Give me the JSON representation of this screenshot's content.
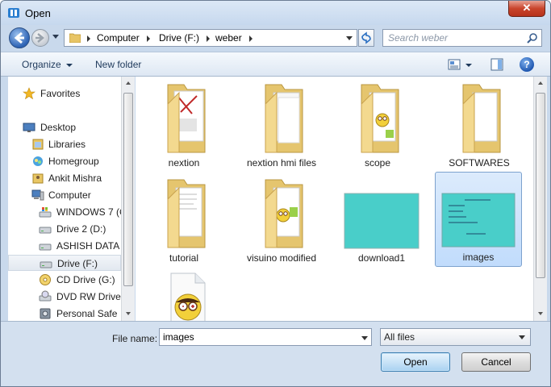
{
  "window": {
    "title": "Open",
    "close_glyph": "✕"
  },
  "navigation": {
    "breadcrumbs": [
      "Computer",
      "Drive (F:)",
      "weber"
    ],
    "search_placeholder": "Search weber"
  },
  "toolbar": {
    "organize_label": "Organize",
    "new_folder_label": "New folder",
    "help_glyph": "?"
  },
  "sidebar": {
    "items": [
      {
        "label": "Favorites",
        "icon": "star-icon"
      },
      {
        "label": "Desktop",
        "icon": "desktop-icon"
      },
      {
        "label": "Libraries",
        "icon": "library-icon"
      },
      {
        "label": "Homegroup",
        "icon": "homegroup-icon"
      },
      {
        "label": "Ankit Mishra",
        "icon": "user-folder-icon"
      },
      {
        "label": "Computer",
        "icon": "computer-icon"
      },
      {
        "label": "WINDOWS 7  (C",
        "icon": "windows-drive-icon"
      },
      {
        "label": "Drive 2 (D:)",
        "icon": "drive-icon"
      },
      {
        "label": "ASHISH DATA",
        "icon": "drive-icon"
      },
      {
        "label": "Drive (F:)",
        "icon": "drive-icon",
        "selected": true
      },
      {
        "label": "CD Drive (G:)",
        "icon": "cd-icon"
      },
      {
        "label": "DVD RW Drive (",
        "icon": "dvd-icon"
      },
      {
        "label": "Personal Safe",
        "icon": "safe-icon"
      }
    ]
  },
  "files": [
    {
      "name": "nextion",
      "type": "folder"
    },
    {
      "name": "nextion hmi files",
      "type": "folder"
    },
    {
      "name": "scope",
      "type": "folder"
    },
    {
      "name": "SOFTWARES",
      "type": "folder"
    },
    {
      "name": "tutorial",
      "type": "folder"
    },
    {
      "name": "visuino modified",
      "type": "folder"
    },
    {
      "name": "download1",
      "type": "image"
    },
    {
      "name": "images",
      "type": "image",
      "selected": true
    },
    {
      "name": "",
      "type": "visuino-file"
    }
  ],
  "footer": {
    "file_name_label": "File name:",
    "file_name_value": "images",
    "filter_value": "All files",
    "open_label": "Open",
    "cancel_label": "Cancel"
  },
  "colors": {
    "accent": "#3c7fb1",
    "image_fill": "#49cec9",
    "folder_fill": "#f5d98b"
  }
}
